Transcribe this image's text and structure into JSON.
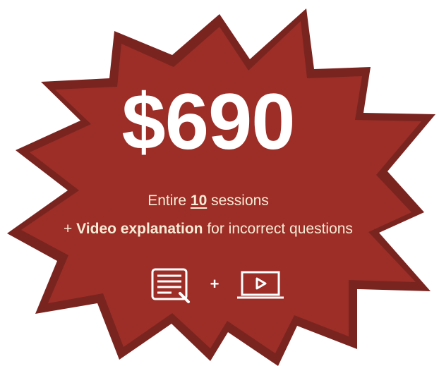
{
  "price": "$690",
  "line1": {
    "prefix": "Entire",
    "sessions_count": "10",
    "suffix": "sessions"
  },
  "line2": {
    "plus": "+",
    "highlight": "Video explanation",
    "rest": "for incorrect questions"
  },
  "icons": {
    "left": "document-pencil-icon",
    "connector": "+",
    "right": "laptop-play-icon"
  },
  "colors": {
    "badge_fill": "#9c2e27",
    "badge_border": "#7a2420",
    "text_cream": "#f7ecd6",
    "text_white": "#ffffff"
  }
}
